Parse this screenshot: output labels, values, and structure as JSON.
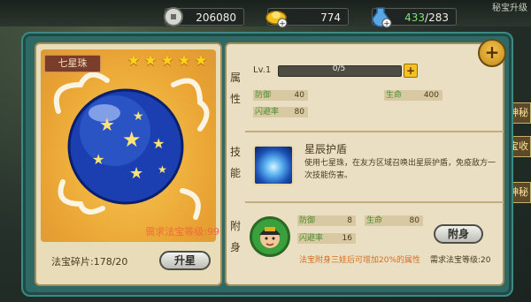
{
  "resources": {
    "silver": "206080",
    "gold": "774",
    "energy_current": "433",
    "energy_sep": "/283"
  },
  "corner_text": "秘宝升级",
  "side_tabs": [
    "神秘",
    "宝收",
    "神秘"
  ],
  "item": {
    "name": "七星珠",
    "stars": 5,
    "need_level": "需求法宝等级:99",
    "fragments": "法宝碎片:178/20",
    "upgrade_button": "升星"
  },
  "attributes": {
    "label": "属性",
    "level": "Lv.1",
    "xp": "0/5",
    "xp_fraction": 0,
    "plus": "+",
    "stats": [
      {
        "key": "防御",
        "value": "40"
      },
      {
        "key": "生命",
        "value": "400"
      },
      {
        "key": "闪避率",
        "value": "80"
      }
    ]
  },
  "skill": {
    "label": "技能",
    "name": "星辰护盾",
    "desc": "使用七星珠，在友方区域召唤出星辰护盾，免疫敌方一次技能伤害。"
  },
  "attach": {
    "label": "附身",
    "stats": [
      {
        "key": "防御",
        "value": "8"
      },
      {
        "key": "生命",
        "value": "80"
      },
      {
        "key": "闪避率",
        "value": "16"
      }
    ],
    "button": "附身",
    "note": "法宝附身三娃后可增加20%的属性",
    "need": "需求法宝等级:20"
  },
  "close_icon": "plus-close-icon"
}
